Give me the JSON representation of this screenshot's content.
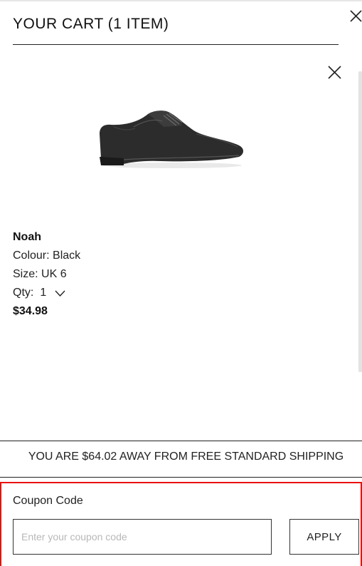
{
  "cart": {
    "title": "YOUR CART (1 ITEM)",
    "close_icon": "close-icon"
  },
  "item": {
    "name": "Noah",
    "colour": "Colour: Black",
    "size": "Size:  UK 6",
    "qty_label": "Qty:",
    "qty_value": "1",
    "price": "$34.98",
    "image": "black-leather-derby-shoe",
    "remove_icon": "close-icon"
  },
  "shipping": {
    "message": "YOU ARE $64.02 AWAY FROM FREE STANDARD SHIPPING"
  },
  "coupon": {
    "label": "Coupon Code",
    "placeholder": "Enter your coupon code",
    "value": "",
    "apply_label": "APPLY",
    "highlight_color": "#e8120c"
  }
}
